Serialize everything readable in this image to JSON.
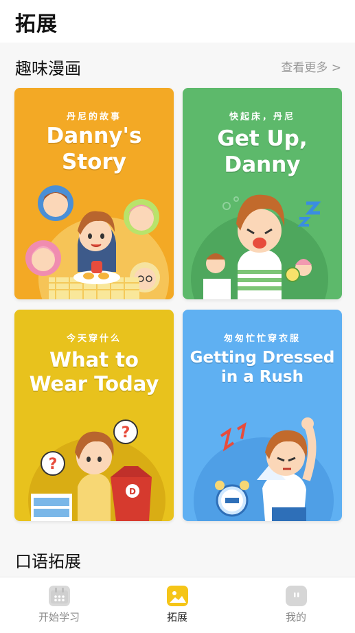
{
  "header": {
    "title": "拓展"
  },
  "comics_section": {
    "title": "趣味漫画",
    "more_label": "查看更多 >",
    "cards": [
      {
        "subtitle": "丹尼的故事",
        "title_line1": "Danny's",
        "title_line2": "Story",
        "bg_color": "#f3a925"
      },
      {
        "subtitle": "快起床，丹尼",
        "title_line1": "Get Up,",
        "title_line2": "Danny",
        "bg_color": "#5db96b"
      },
      {
        "subtitle": "今天穿什么",
        "title_line1": "What to",
        "title_line2": "Wear Today",
        "bg_color": "#e8c21d"
      },
      {
        "subtitle": "匆匆忙忙穿衣服",
        "title_line1": "Getting Dressed",
        "title_line2": "in a Rush",
        "bg_color": "#5fb0f2"
      }
    ]
  },
  "speaking_section": {
    "title": "口语拓展"
  },
  "tabbar": {
    "items": [
      {
        "label": "开始学习",
        "icon": "calendar-icon",
        "active": false
      },
      {
        "label": "拓展",
        "icon": "picture-icon",
        "active": true
      },
      {
        "label": "我的",
        "icon": "robot-face-icon",
        "active": false
      }
    ]
  }
}
